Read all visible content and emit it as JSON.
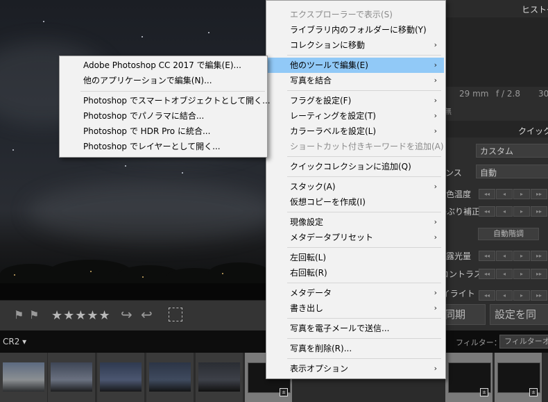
{
  "colors": {
    "menu_bg": "#f2f2f2",
    "highlight": "#91c9f7",
    "disabled": "#8a8a8a",
    "panel_bg": "#2d2d2d"
  },
  "right_panel": {
    "histogram_title": "ヒストグ",
    "exif": {
      "focal": "29 mm",
      "aperture": "f / 2.8",
      "shutter": "30"
    },
    "exif_suffix": "無",
    "quick_develop_title": "クイック現",
    "preset_value": "カスタム",
    "wb_label": "ンス",
    "wb_value": "自動",
    "temp_label": "色温度",
    "tint_label": "色かぶり補正",
    "auto_tone": "自動階調",
    "exposure_label": "露光量",
    "contrast_label": "コントラスト",
    "highlights_label": "ハイライト",
    "sync_label": "同期",
    "reset_label": "設定を同"
  },
  "toolbar": {
    "stars": "★★★★★"
  },
  "filmstrip": {
    "filename_suffix": "CR2 ▾",
    "filter_label": "フィルター：",
    "filter_value": "フィルターオフ"
  },
  "context_menu": {
    "items": [
      {
        "label": "エクスプローラーで表示(S)",
        "disabled": true
      },
      {
        "label": "ライブラリ内のフォルダーに移動(Y)"
      },
      {
        "label": "コレクションに移動",
        "arrow": "›"
      },
      {
        "label": "他のツールで編集(E)",
        "arrow": "›",
        "highlight": true
      },
      {
        "label": "写真を結合",
        "arrow": "›"
      },
      {
        "label": "フラグを設定(F)",
        "arrow": "›"
      },
      {
        "label": "レーティングを設定(T)",
        "arrow": "›"
      },
      {
        "label": "カラーラベルを設定(L)",
        "arrow": "›"
      },
      {
        "label": "ショートカット付きキーワードを追加(A)",
        "disabled": true
      },
      {
        "label": "クイックコレクションに追加(Q)"
      },
      {
        "label": "スタック(A)",
        "arrow": "›"
      },
      {
        "label": "仮想コピーを作成(I)"
      },
      {
        "label": "現像設定",
        "arrow": "›"
      },
      {
        "label": "メタデータプリセット",
        "arrow": "›"
      },
      {
        "label": "左回転(L)"
      },
      {
        "label": "右回転(R)"
      },
      {
        "label": "メタデータ",
        "arrow": "›"
      },
      {
        "label": "書き出し",
        "arrow": "›"
      },
      {
        "label": "写真を電子メールで送信..."
      },
      {
        "label": "写真を削除(R)..."
      },
      {
        "label": "表示オプション",
        "arrow": "›"
      }
    ]
  },
  "submenu": {
    "items": [
      {
        "label": "Adobe Photoshop CC 2017 で編集(E)..."
      },
      {
        "label": "他のアプリケーションで編集(N)..."
      },
      {
        "label": "Photoshop でスマートオブジェクトとして開く..."
      },
      {
        "label": "Photoshop でパノラマに結合..."
      },
      {
        "label": "Photoshop で HDR Pro に統合..."
      },
      {
        "label": "Photoshop でレイヤーとして開く..."
      }
    ]
  }
}
